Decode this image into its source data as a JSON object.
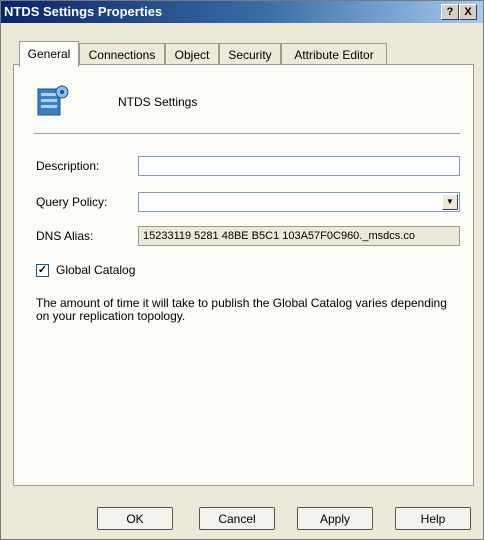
{
  "window": {
    "title": "NTDS Settings Properties",
    "help_glyph": "?",
    "close_glyph": "X"
  },
  "tabs": [
    {
      "label": "General",
      "active": true
    },
    {
      "label": "Connections",
      "active": false
    },
    {
      "label": "Object",
      "active": false
    },
    {
      "label": "Security",
      "active": false
    },
    {
      "label": "Attribute Editor",
      "active": false
    }
  ],
  "header": {
    "icon": "ntds-settings-icon",
    "label": "NTDS Settings"
  },
  "fields": {
    "description": {
      "label": "Description:",
      "value": ""
    },
    "query_policy": {
      "label": "Query Policy:",
      "value": "",
      "arrow_glyph": "▼"
    },
    "dns_alias": {
      "label": "DNS Alias:",
      "value": "15233119 5281 48BE B5C1 103A57F0C960._msdcs.co"
    }
  },
  "global_catalog": {
    "label": "Global Catalog",
    "checked": true,
    "check_glyph": "✓"
  },
  "info_text": "The amount of time it will take to publish the Global Catalog varies depending on your replication topology.",
  "buttons": {
    "ok": "OK",
    "cancel": "Cancel",
    "apply": "Apply",
    "help": "Help"
  },
  "colors": {
    "title_bar": "#0a246a",
    "dialog_face": "#ece9d8",
    "panel": "#fbfbf8"
  }
}
